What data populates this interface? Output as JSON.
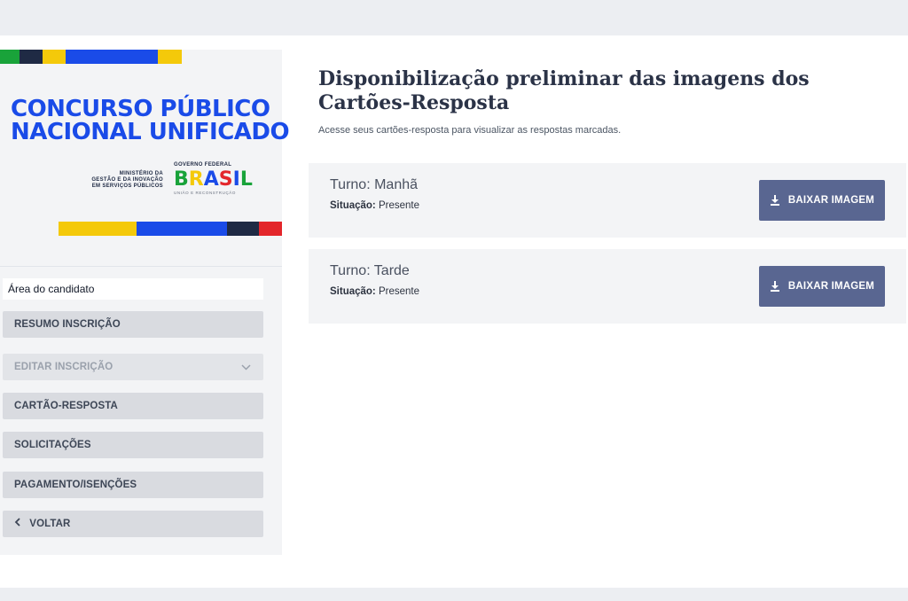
{
  "brand": {
    "title_line1": "CONCURSO PÚBLICO",
    "title_line2": "NACIONAL UNIFICADO",
    "ministry_line1": "MINISTÉRIO DA",
    "ministry_line2": "GESTÃO E DA INOVAÇÃO",
    "ministry_line3": "EM SERVIÇOS PÚBLICOS",
    "gov_label": "GOVERNO FEDERAL",
    "gov_logo": "BRASIL",
    "gov_sub": "UNIÃO E RECONSTRUÇÃO",
    "colors": {
      "blue": "#1a4be8",
      "green": "#19a33a",
      "yellow": "#f4c90a",
      "red": "#e3262b",
      "dark": "#1f2a44"
    }
  },
  "sidebar": {
    "area_label": "Área do candidato",
    "items": [
      {
        "label": "RESUMO INSCRIÇÃO",
        "state": "enabled"
      },
      {
        "label": "EDITAR INSCRIÇÃO",
        "state": "disabled",
        "icon": "chevron-down-icon"
      },
      {
        "label": "CARTÃO-RESPOSTA",
        "state": "enabled"
      },
      {
        "label": "SOLICITAÇÕES",
        "state": "enabled"
      },
      {
        "label": "PAGAMENTO/ISENÇÕES",
        "state": "enabled"
      },
      {
        "label": "VOLTAR",
        "state": "enabled",
        "icon": "chevron-left-icon"
      }
    ]
  },
  "main": {
    "title": "Disponibilização preliminar das imagens dos Cartões-Resposta",
    "subtitle": "Acesse seus cartões-resposta para visualizar as respostas marcadas.",
    "cards": [
      {
        "turno": "Turno: Manhã",
        "situacao_label": "Situação:",
        "situacao_value": "Presente",
        "button": "BAIXAR IMAGEM"
      },
      {
        "turno": "Turno: Tarde",
        "situacao_label": "Situação:",
        "situacao_value": "Presente",
        "button": "BAIXAR IMAGEM"
      }
    ],
    "button_color": "#596691"
  }
}
